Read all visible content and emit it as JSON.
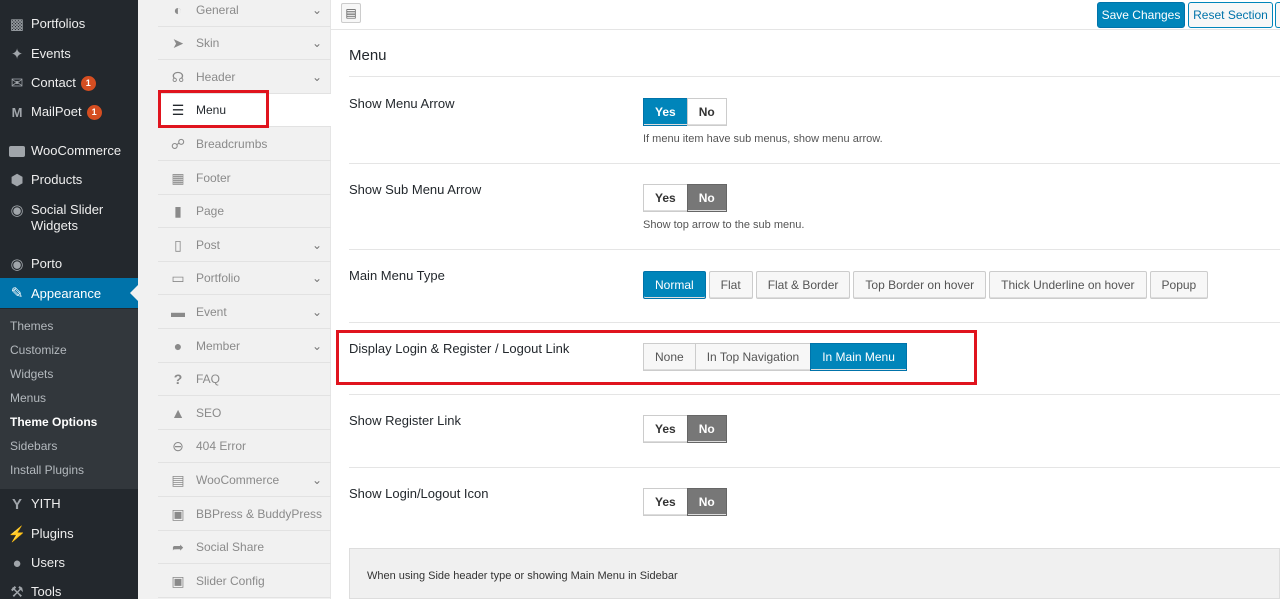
{
  "wp_menu": {
    "items": [
      {
        "label": "Portfolios",
        "icon": "portfolio-icon"
      },
      {
        "label": "Events",
        "icon": "pin-icon"
      },
      {
        "label": "Contact",
        "icon": "mail-icon",
        "badge": "1"
      },
      {
        "label": "MailPoet",
        "icon": "mailpoet-icon",
        "badge": "1"
      },
      {
        "label": "WooCommerce",
        "icon": "woo-icon"
      },
      {
        "label": "Products",
        "icon": "box-icon"
      },
      {
        "label": "Social Slider Widgets",
        "icon": "camera-icon"
      },
      {
        "label": "Porto",
        "icon": "porto-icon"
      },
      {
        "label": "Appearance",
        "icon": "brush-icon"
      },
      {
        "label": "YITH",
        "icon": "yith-icon"
      },
      {
        "label": "Plugins",
        "icon": "plug-icon"
      },
      {
        "label": "Users",
        "icon": "user-icon"
      },
      {
        "label": "Tools",
        "icon": "wrench-icon"
      }
    ],
    "submenu": [
      "Themes",
      "Customize",
      "Widgets",
      "Menus",
      "Theme Options",
      "Sidebars",
      "Install Plugins"
    ]
  },
  "options_nav": {
    "items": [
      {
        "label": "General"
      },
      {
        "label": "Skin"
      },
      {
        "label": "Header"
      },
      {
        "label": "Menu"
      },
      {
        "label": "Breadcrumbs"
      },
      {
        "label": "Footer"
      },
      {
        "label": "Page"
      },
      {
        "label": "Post"
      },
      {
        "label": "Portfolio"
      },
      {
        "label": "Event"
      },
      {
        "label": "Member"
      },
      {
        "label": "FAQ"
      },
      {
        "label": "SEO"
      },
      {
        "label": "404 Error"
      },
      {
        "label": "WooCommerce"
      },
      {
        "label": "BBPress & BuddyPress"
      },
      {
        "label": "Social Share"
      },
      {
        "label": "Slider Config"
      }
    ]
  },
  "toolbar": {
    "save_label": "Save Changes",
    "reset_label": "Reset Section"
  },
  "section": {
    "title": "Menu"
  },
  "options": {
    "show_menu_arrow": {
      "label": "Show Menu Arrow",
      "yes": "Yes",
      "no": "No",
      "value": "Yes",
      "desc": "If menu item have sub menus, show menu arrow."
    },
    "show_sub_menu_arrow": {
      "label": "Show Sub Menu Arrow",
      "yes": "Yes",
      "no": "No",
      "value": "No",
      "desc": "Show top arrow to the sub menu."
    },
    "main_menu_type": {
      "label": "Main Menu Type",
      "choices": [
        "Normal",
        "Flat",
        "Flat & Border",
        "Top Border on hover",
        "Thick Underline on hover",
        "Popup"
      ],
      "value": "Normal"
    },
    "login_link": {
      "label": "Display Login & Register / Logout Link",
      "choices": [
        "None",
        "In Top Navigation",
        "In Main Menu"
      ],
      "value": "In Main Menu"
    },
    "show_register_link": {
      "label": "Show Register Link",
      "yes": "Yes",
      "no": "No",
      "value": "No"
    },
    "show_login_icon": {
      "label": "Show Login/Logout Icon",
      "yes": "Yes",
      "no": "No",
      "value": "No"
    }
  },
  "note": {
    "text": "When using Side header type or showing Main Menu in Sidebar"
  },
  "colors": {
    "accent": "#0085ba",
    "sidebar": "#23282d",
    "active_menu": "#0073aa",
    "highlight": "#e0141e"
  }
}
